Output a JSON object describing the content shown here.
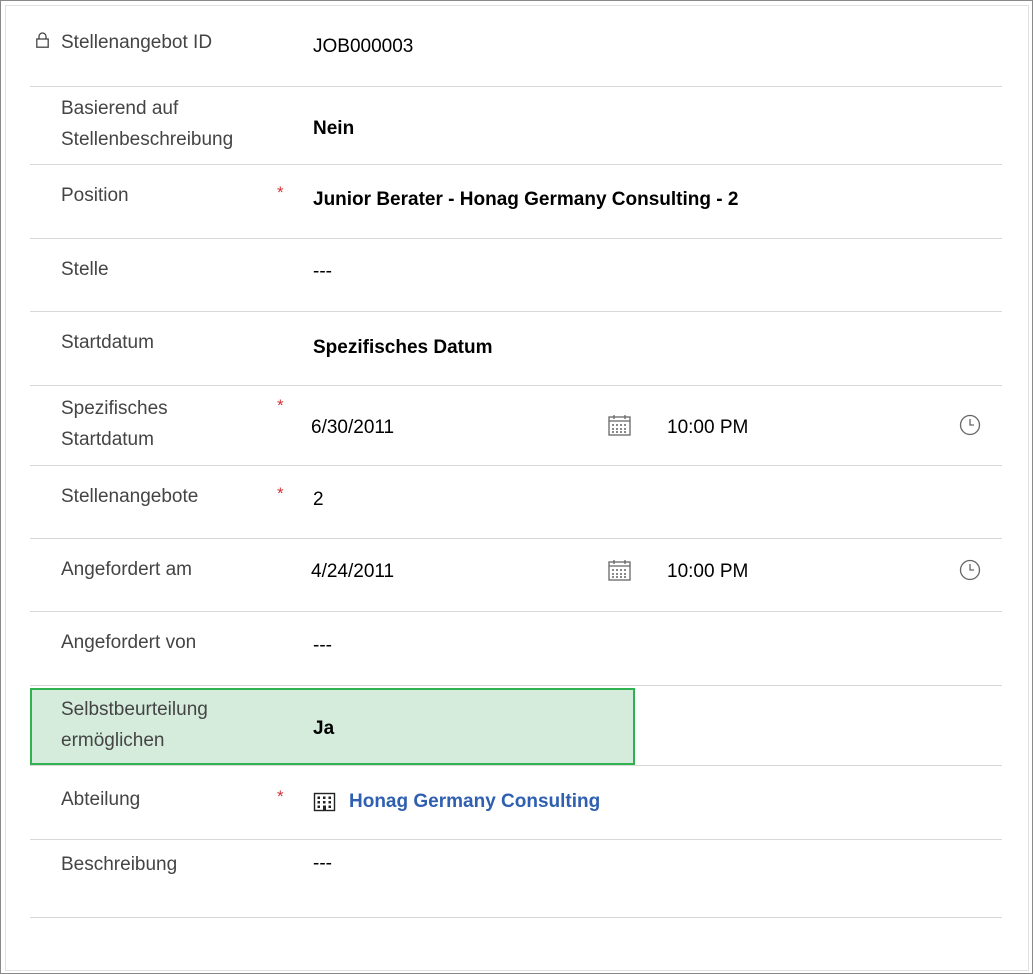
{
  "rows": [
    {
      "label": "Stellenangebot ID",
      "value": "JOB000003"
    },
    {
      "label_line1": "Basierend auf",
      "label_line2": "Stellenbeschreibung",
      "value": "Nein"
    },
    {
      "label": "Position",
      "required": "*",
      "value": "Junior Berater - Honag Germany Consulting - 2"
    },
    {
      "label": "Stelle",
      "value": "---"
    },
    {
      "label": "Startdatum",
      "value": "Spezifisches Datum"
    },
    {
      "label_line1": "Spezifisches",
      "label_line2": "Startdatum",
      "required": "*",
      "date": "6/30/2011",
      "time": "10:00 PM"
    },
    {
      "label": "Stellenangebote",
      "required": "*",
      "value": "2"
    },
    {
      "label": "Angefordert am",
      "date": "4/24/2011",
      "time": "10:00 PM"
    },
    {
      "label": "Angefordert von",
      "value": "---"
    },
    {
      "label_line1": "Selbstbeurteilung",
      "label_line2": "ermöglichen",
      "value": "Ja"
    },
    {
      "label": "Abteilung",
      "required": "*",
      "value": "Honag Germany Consulting"
    },
    {
      "label": "Beschreibung",
      "value": "---"
    }
  ],
  "colors": {
    "required": "#d13438",
    "link": "#2e5fb0",
    "highlight_bg": "#d5ecdc",
    "highlight_border": "#2fb24f"
  },
  "icons": [
    "lock-icon",
    "calendar-icon",
    "clock-icon",
    "building-icon"
  ]
}
